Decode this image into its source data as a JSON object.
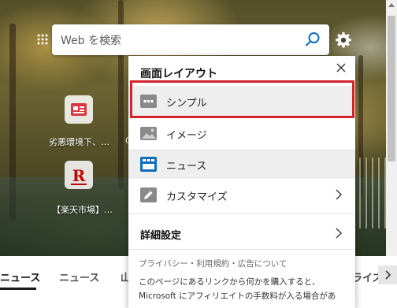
{
  "search": {
    "placeholder": "Web を検索"
  },
  "quick_links": [
    {
      "label": "劣悪環境下、…",
      "tile_color": "#d9363e"
    },
    {
      "label": "【楽天市場】…",
      "tile_color": "#bf0000",
      "glyph": "R"
    }
  ],
  "quick_links_partial": [
    "C",
    "【"
  ],
  "layout_panel": {
    "title": "画面レイアウト",
    "options": [
      {
        "label": "シンプル",
        "icon": "dots-icon",
        "selected": true
      },
      {
        "label": "イメージ",
        "icon": "image-icon",
        "selected": false
      },
      {
        "label": "ニュース",
        "icon": "news-icon",
        "selected": false
      },
      {
        "label": "カスタマイズ",
        "icon": "pencil-icon",
        "selected": false
      }
    ],
    "details_label": "詳細設定",
    "privacy_link": "プライバシー・利用規約・広告について",
    "affiliate_note": "このページにあるリンクから何かを購入すると、Microsoft にアフィリエイトの手数料が入る場合があ"
  },
  "bottom_nav": {
    "tabs": [
      "ニュース",
      "ニュース",
      "山"
    ],
    "right_tab": "ライズ"
  },
  "colors": {
    "highlight": "#d3232d",
    "news_icon_blue": "#0f6cbd",
    "search_icon": "#0f6cbd"
  }
}
